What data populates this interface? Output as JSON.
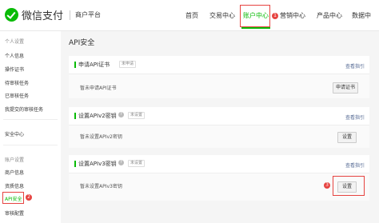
{
  "header": {
    "brand": "微信支付",
    "platform": "商户平台",
    "nav": [
      "首页",
      "交易中心",
      "账户中心",
      "营销中心",
      "产品中心",
      "数据中"
    ],
    "active_index": 2,
    "markers": {
      "nav": "1"
    }
  },
  "sidebar": {
    "groups": [
      {
        "title": "个人设置",
        "items": [
          "个人信息",
          "操作证书",
          "待审核任务",
          "已审核任务",
          "我提交的审核任务"
        ]
      },
      {
        "title": "",
        "items": [
          "安全中心"
        ]
      },
      {
        "title": "账户设置",
        "items": [
          "商户信息",
          "资质信息",
          "API安全",
          "审核配置"
        ]
      }
    ],
    "active_item": "API安全",
    "marker": "2"
  },
  "main": {
    "title": "API安全",
    "cards": [
      {
        "title": "申请API证书",
        "tag": "未申请",
        "guide": "查看指引",
        "body": "暂未申请API证书",
        "button": "申请证书"
      },
      {
        "title": "设置APIv2密钥",
        "tag": "未设置",
        "guide": "查看指引",
        "body": "暂未设置APIv2密钥",
        "button": "设置"
      },
      {
        "title": "设置APIv3密钥",
        "tag": "未设置",
        "guide": "查看指引",
        "body": "暂未设置APIv3密钥",
        "button": "设置",
        "marker": "3"
      }
    ]
  },
  "colors": {
    "accent": "#09bb07",
    "highlight": "#e64340",
    "link": "#576b95"
  },
  "icons": {
    "logo": "wechat-pay-logo",
    "help": "question-circle-icon"
  }
}
